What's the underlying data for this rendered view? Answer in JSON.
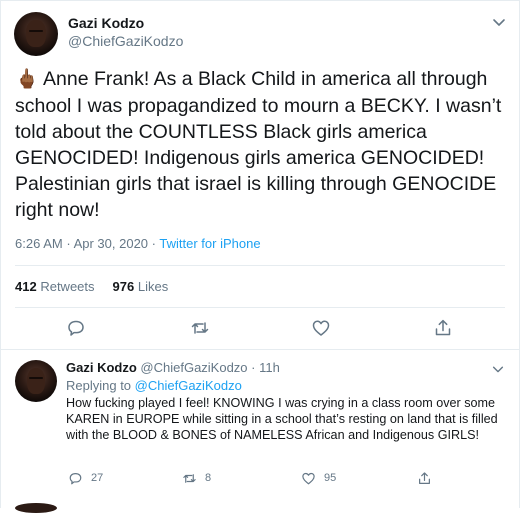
{
  "tweet": {
    "display_name": "Gazi Kodzo",
    "handle": "@ChiefGaziKodzo",
    "emoji": "🖕🏾",
    "text": "Anne Frank! As a Black Child in america all through school I was propagandized to mourn a BECKY. I wasn’t told about the COUNTLESS Black girls america GENOCIDED! Indigenous girls america GENOCIDED! Palestinian girls that israel is killing through GENOCIDE right now!",
    "time": "6:26 AM",
    "separator": "·",
    "date": "Apr 30, 2020",
    "source": "Twitter for iPhone",
    "retweets_count": "412",
    "retweets_label": "Retweets",
    "likes_count": "976",
    "likes_label": "Likes"
  },
  "reply": {
    "display_name": "Gazi Kodzo",
    "handle": "@ChiefGaziKodzo",
    "separator": "·",
    "time": "11h",
    "replying_prefix": "Replying to",
    "replying_mention": "@ChiefGaziKodzo",
    "text": "How fucking played I feel! KNOWING I was crying in a class room over some KAREN in EUROPE while sitting in a school that’s resting on land that is filled with the BLOOD & BONES of NAMELESS African and Indigenous GIRLS!",
    "reply_count": "27",
    "retweet_count": "8",
    "like_count": "95"
  },
  "icons": {
    "caret": "chevron-down-icon",
    "reply": "reply-icon",
    "retweet": "retweet-icon",
    "like": "heart-icon",
    "share": "share-icon"
  },
  "colors": {
    "accent": "#1da1f2",
    "secondary_text": "#657786",
    "primary_text": "#14171a",
    "divider": "#e6ecf0"
  }
}
